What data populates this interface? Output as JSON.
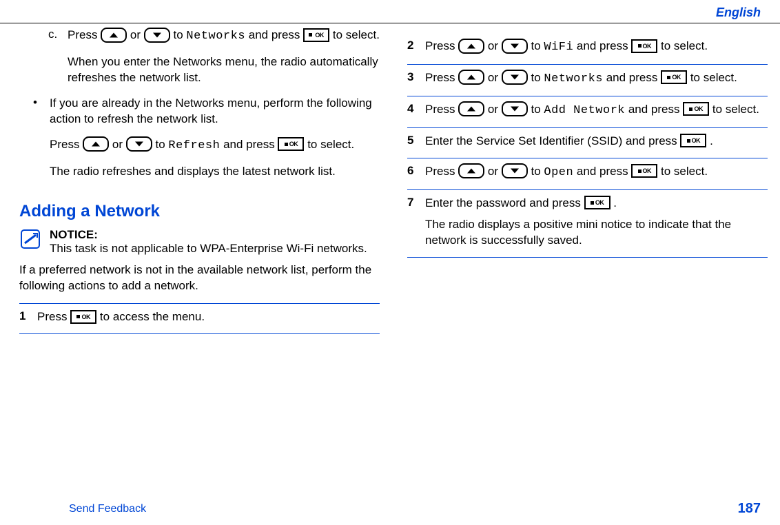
{
  "header": {
    "language": "English"
  },
  "left": {
    "c_marker": "c.",
    "c_text_1a": "Press ",
    "c_text_1b": " or ",
    "c_text_1c": " to ",
    "c_mono": "Networks",
    "c_text_1d": " and press ",
    "c_text_1e": " to select.",
    "c_para2": "When you enter the Networks menu, the radio automatically refreshes the network list.",
    "bullet_marker": "•",
    "bullet_text": "If you are already in the Networks menu, perform the following action to refresh the network list.",
    "bullet_p2a": "Press ",
    "bullet_p2b": " or ",
    "bullet_p2c": " to ",
    "bullet_mono": "Refresh",
    "bullet_p2d": " and press ",
    "bullet_p2e": " to select.",
    "bullet_p3": "The radio refreshes and displays the latest network list.",
    "heading": "Adding a Network",
    "notice_label": "NOTICE:",
    "notice_text": "This task is not applicable to WPA-Enterprise Wi-Fi networks.",
    "intro": "If a preferred network is not in the available network list, perform the following actions to add a network.",
    "step1_num": "1",
    "step1_a": "Press ",
    "step1_b": " to access the menu."
  },
  "right": {
    "steps": [
      {
        "num": "2",
        "p1a": "Press ",
        "p1b": " or ",
        "p1c": " to ",
        "mono": "WiFi",
        "p1d": " and press ",
        "p1e": " to select."
      },
      {
        "num": "3",
        "p1a": "Press ",
        "p1b": " or ",
        "p1c": " to ",
        "mono": "Networks",
        "p1d": " and press ",
        "p1e": " to select."
      },
      {
        "num": "4",
        "p1a": "Press ",
        "p1b": " or ",
        "p1c": " to ",
        "mono": "Add Network",
        "p1d": " and press ",
        "p1e": " to select."
      },
      {
        "num": "5",
        "simple_a": "Enter the Service Set Identifier (SSID) and press ",
        "simple_b": " ."
      },
      {
        "num": "6",
        "p1a": "Press ",
        "p1b": " or ",
        "p1c": " to ",
        "mono": "Open",
        "p1d": " and press ",
        "p1e": " to select."
      },
      {
        "num": "7",
        "simple_a": "Enter the password and press ",
        "simple_b": " .",
        "extra": "The radio displays a positive mini notice to indicate that the network is successfully saved."
      }
    ]
  },
  "footer": {
    "feedback": "Send Feedback",
    "page": "187"
  },
  "ok_label": "OK"
}
